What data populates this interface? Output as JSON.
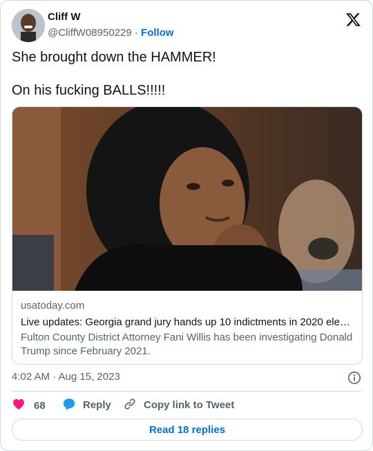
{
  "author": {
    "display_name": "Cliff W",
    "handle": "@CliffW08950229",
    "separator": "·",
    "follow_label": "Follow"
  },
  "tweet": {
    "line1": "She brought down the HAMMER!",
    "line2": "On his fucking BALLS!!!!!"
  },
  "link_card": {
    "domain": "usatoday.com",
    "title": "Live updates: Georgia grand jury hands up 10 indictments in 2020 elect…",
    "description": "Fulton County District Attorney Fani Willis has been investigating Donald Trump since February 2021."
  },
  "meta": {
    "timestamp": "4:02 AM · Aug 15, 2023"
  },
  "actions": {
    "like_count": "68",
    "reply_label": "Reply",
    "copy_label": "Copy link to Tweet"
  },
  "read_replies_label": "Read 18 replies",
  "colors": {
    "accent": "#006fd6",
    "like": "#f91880",
    "reply": "#1d9bf0",
    "muted": "#536471",
    "border": "#cfd9de"
  },
  "icons": {
    "brand": "x-logo-icon",
    "info": "info-icon",
    "like": "heart-icon",
    "reply": "speech-bubble-icon",
    "copy": "link-icon"
  }
}
